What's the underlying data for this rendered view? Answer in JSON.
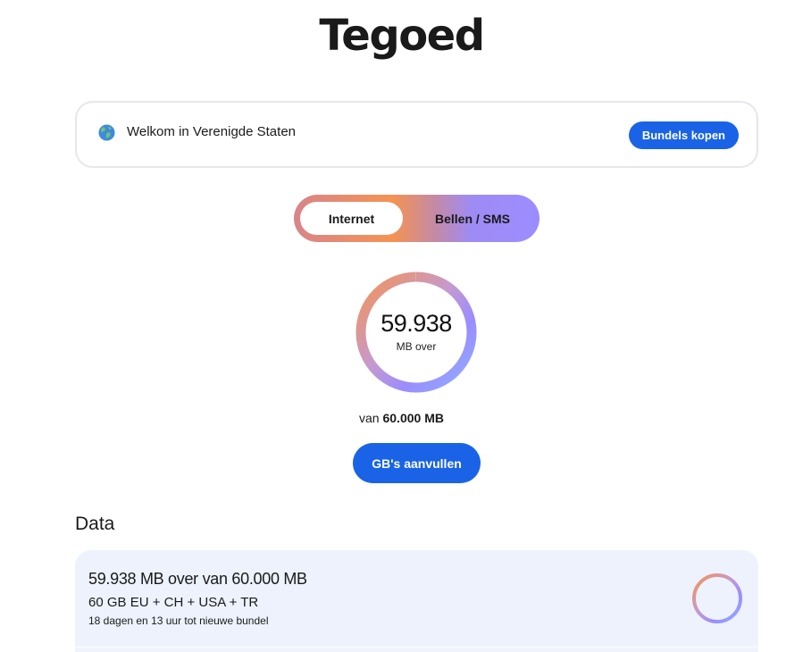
{
  "page": {
    "title": "Tegoed"
  },
  "welcome": {
    "text": "Welkom in Verenigde Staten",
    "button_label": "Bundels kopen",
    "icon": "globe-icon"
  },
  "tabs": [
    {
      "label": "Internet",
      "selected": true
    },
    {
      "label": "Bellen / SMS",
      "selected": false
    }
  ],
  "usage": {
    "remaining": "59.938",
    "unit_label": "MB over",
    "total_prefix": "van",
    "total": "60.000 MB",
    "remaining_fraction": 0.999
  },
  "topup": {
    "button_label": "GB's aanvullen"
  },
  "data_section": {
    "title": "Data",
    "card": {
      "heading": "59.938 MB over van 60.000 MB",
      "bundle": "60 GB EU + CH + USA + TR",
      "remaining_time": "18 dagen en 13 uur tot nieuwe bundel"
    }
  },
  "colors": {
    "primary": "#1a63e6",
    "accent_orange": "#f59352",
    "accent_purple": "#9b8cff",
    "accent_blue": "#8eb0ff",
    "card_bg": "#edf2fd"
  }
}
